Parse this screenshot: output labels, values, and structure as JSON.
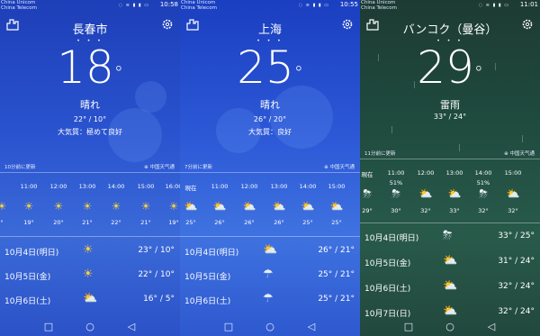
{
  "panels": [
    {
      "status": {
        "carrier1": "China Unicom",
        "carrier2": "China Telecom",
        "icons": "◌ ≋ ▮ ▮ ▭",
        "time": "10:58"
      },
      "header": {
        "city": "長春市",
        "dots": "• • •",
        "buildings_icon": "city-list-icon",
        "settings_icon": "gear-icon"
      },
      "current": {
        "temp": "18",
        "degree": "°",
        "condition": "晴れ",
        "range": "22° / 10°",
        "air_quality": "大気質：極めて良好"
      },
      "source": {
        "updated": "10分前に更新",
        "provider": "中国天气通"
      },
      "hourly": {
        "times": [
          "",
          "11:00",
          "12:00",
          "13:00",
          "14:00",
          "15:00",
          "16:00"
        ],
        "precip": [
          "",
          "",
          "",
          "",
          "",
          "",
          ""
        ],
        "icons": [
          "sun",
          "sun",
          "sun",
          "sun",
          "sun",
          "sun",
          "sun"
        ],
        "temps": [
          "",
          "19°",
          "20°",
          "21°",
          "22°",
          "21°",
          "19°"
        ]
      },
      "daily": [
        {
          "day": "10月4日(明日)",
          "icon": "sun",
          "range": "23° / 10°"
        },
        {
          "day": "10月5日(金)",
          "icon": "sun",
          "range": "22° / 10°"
        },
        {
          "day": "10月6日(土)",
          "icon": "partly-cloudy",
          "range": "16° / 5°"
        }
      ],
      "nav": {
        "back": "◁",
        "home": "○",
        "recent": "□"
      }
    },
    {
      "status": {
        "carrier1": "China Unicom",
        "carrier2": "China Telecom",
        "icons": "◌ ≋ ▮ ▮ ▭",
        "time": "10:55"
      },
      "header": {
        "city": "上海",
        "dots": "• • •",
        "buildings_icon": "city-list-icon",
        "settings_icon": "gear-icon"
      },
      "current": {
        "temp": "25",
        "degree": "°",
        "condition": "晴れ",
        "range": "26° / 20°",
        "air_quality": "大気質：良好"
      },
      "source": {
        "updated": "7分前に更新",
        "provider": "中国天气通"
      },
      "hourly": {
        "times": [
          "現在",
          "11:00",
          "12:00",
          "13:00",
          "14:00",
          "15:00"
        ],
        "precip": [
          "",
          "",
          "",
          "",
          "",
          ""
        ],
        "icons": [
          "partly-cloudy",
          "partly-cloudy",
          "partly-cloudy",
          "partly-cloudy",
          "partly-cloudy",
          "partly-cloudy"
        ],
        "temps": [
          "25°",
          "26°",
          "26°",
          "26°",
          "25°",
          "25°"
        ]
      },
      "daily": [
        {
          "day": "10月4日(明日)",
          "icon": "partly-cloudy",
          "range": "26° / 21°"
        },
        {
          "day": "10月5日(金)",
          "icon": "rain",
          "range": "25° / 21°"
        },
        {
          "day": "10月6日(土)",
          "icon": "rain",
          "range": "25° / 21°"
        }
      ],
      "nav": {
        "back": "◁",
        "home": "○",
        "recent": "□"
      }
    },
    {
      "status": {
        "carrier1": "China Unicom",
        "carrier2": "China Telecom",
        "icons": "◌ ≋ ▮ ▮ ▭",
        "time": "11:01"
      },
      "header": {
        "city": "バンコク（曼谷）",
        "dots": "• • •",
        "buildings_icon": "city-list-icon",
        "settings_icon": "gear-icon"
      },
      "current": {
        "temp": "29",
        "degree": "°",
        "condition": "雷雨",
        "range": "33° / 24°",
        "air_quality": ""
      },
      "source": {
        "updated": "11分前に更新",
        "provider": "中国天气通"
      },
      "hourly": {
        "times": [
          "現在",
          "11:00",
          "12:00",
          "13:00",
          "14:00",
          "15:00"
        ],
        "precip": [
          "",
          "51%",
          "",
          "",
          "51%",
          ""
        ],
        "icons": [
          "thunderstorm",
          "thunderstorm",
          "partly-cloudy",
          "partly-cloudy",
          "thunderstorm",
          "partly-cloudy"
        ],
        "temps": [
          "29°",
          "30°",
          "32°",
          "33°",
          "32°",
          "32°"
        ]
      },
      "daily": [
        {
          "day": "10月4日(明日)",
          "icon": "thunderstorm",
          "range": "33° / 25°"
        },
        {
          "day": "10月5日(金)",
          "icon": "partly-cloudy",
          "range": "31° / 24°"
        },
        {
          "day": "10月6日(土)",
          "icon": "partly-cloudy",
          "range": "32° / 24°"
        },
        {
          "day": "10月7日(日)",
          "icon": "partly-cloudy",
          "range": "32° / 24°"
        }
      ],
      "nav": {
        "back": "◁",
        "home": "○",
        "recent": "□"
      }
    }
  ]
}
